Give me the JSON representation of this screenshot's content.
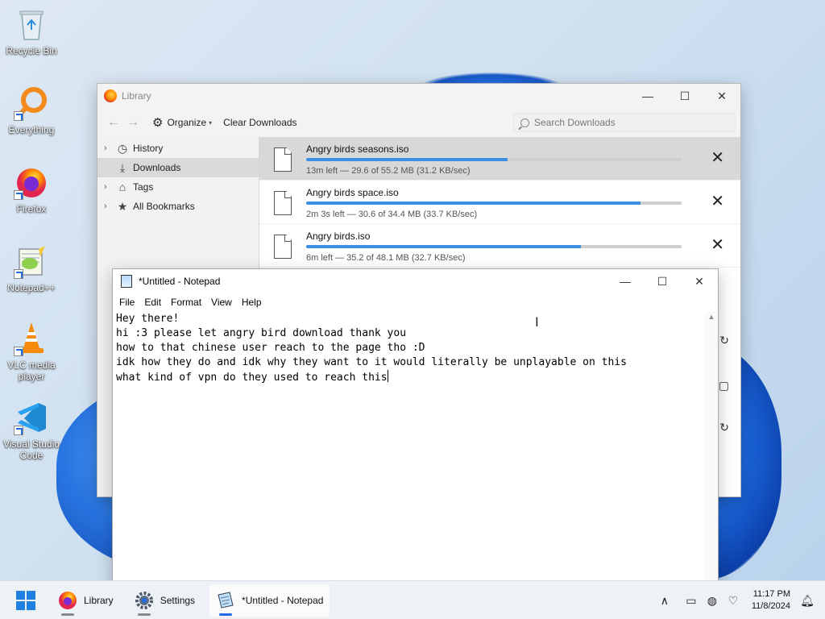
{
  "desktop": {
    "icons": [
      {
        "label": "Recycle Bin",
        "icon": "recycle-bin-icon"
      },
      {
        "label": "Everything",
        "icon": "everything-search-icon"
      },
      {
        "label": "Firefox",
        "icon": "firefox-icon"
      },
      {
        "label": "Notepad++",
        "icon": "notepadpp-icon"
      },
      {
        "label": "VLC media player",
        "icon": "vlc-cone-icon"
      },
      {
        "label": "Visual Studio Code",
        "icon": "vscode-icon"
      }
    ]
  },
  "library": {
    "title": "Library",
    "toolbar": {
      "organize": "Organize",
      "clear": "Clear Downloads",
      "search_placeholder": "Search Downloads"
    },
    "sidebar": [
      {
        "label": "History",
        "icon": "clock-icon",
        "chevron": true
      },
      {
        "label": "Downloads",
        "icon": "download-icon",
        "chevron": false
      },
      {
        "label": "Tags",
        "icon": "tag-icon",
        "chevron": true
      },
      {
        "label": "All Bookmarks",
        "icon": "star-icon",
        "chevron": true
      }
    ],
    "downloads": [
      {
        "name": "Angry birds seasons.iso",
        "status": "13m left — 29.6 of 55.2 MB (31.2 KB/sec)",
        "progress": 0.536
      },
      {
        "name": "Angry birds space.iso",
        "status": "2m 3s left — 30.6 of 34.4 MB (33.7 KB/sec)",
        "progress": 0.89
      },
      {
        "name": "Angry birds.iso",
        "status": "6m left — 35.2 of 48.1 MB (32.7 KB/sec)",
        "progress": 0.732
      }
    ]
  },
  "notepad": {
    "title": "*Untitled - Notepad",
    "menu": [
      "File",
      "Edit",
      "Format",
      "View",
      "Help"
    ],
    "lines": [
      "Hey there!",
      "hi :3 please let angry bird download thank you",
      "how to that chinese user reach to the page tho :D",
      "idk how they do and idk why they want to it would literally be unplayable on this",
      "what kind of vpn do they used to reach this"
    ]
  },
  "taskbar": {
    "apps": [
      {
        "label": "Library",
        "icon": "firefox-icon",
        "active": false
      },
      {
        "label": "Settings",
        "icon": "settings-gear-icon",
        "active": false
      },
      {
        "label": "*Untitled - Notepad",
        "icon": "notepad-icon",
        "active": true
      }
    ],
    "time": "11:17 PM",
    "date": "11/8/2024"
  }
}
